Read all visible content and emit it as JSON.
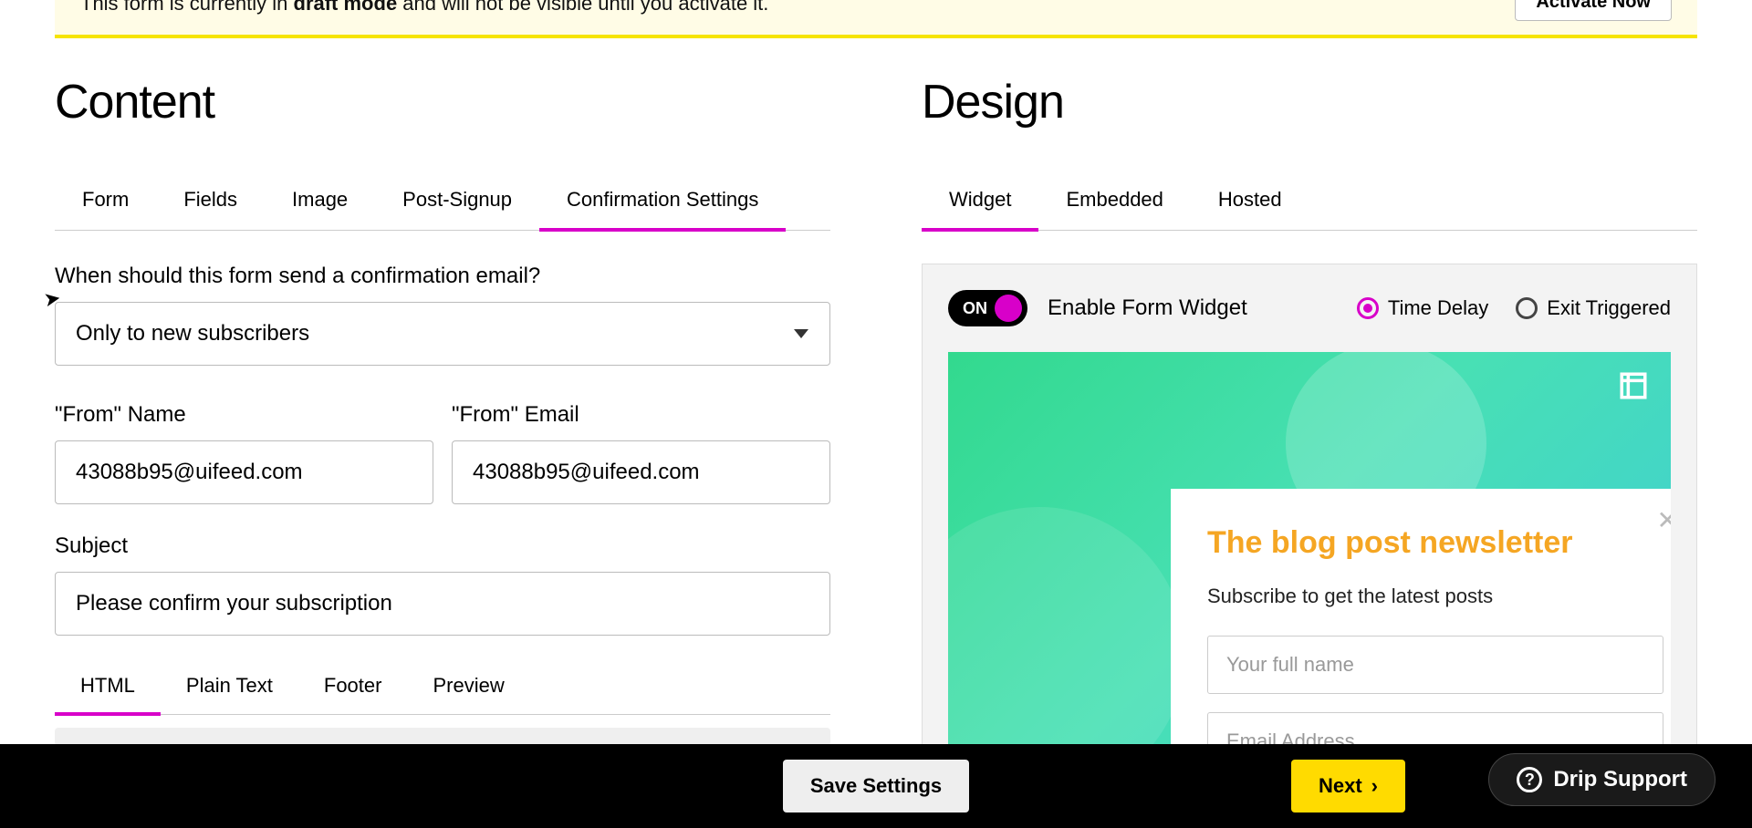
{
  "banner": {
    "prefix": "This form is currently in ",
    "bold": "draft mode",
    "suffix": " and will not be visible until you activate it.",
    "button": "Activate Now"
  },
  "content": {
    "title": "Content",
    "tabs": [
      "Form",
      "Fields",
      "Image",
      "Post-Signup",
      "Confirmation Settings"
    ],
    "active_tab": 4,
    "confirmation_label": "When should this form send a confirmation email?",
    "confirmation_value": "Only to new subscribers",
    "from_name_label": "\"From\" Name",
    "from_name_value": "43088b95@uifeed.com",
    "from_email_label": "\"From\" Email",
    "from_email_value": "43088b95@uifeed.com",
    "subject_label": "Subject",
    "subject_value": "Please confirm your subscription",
    "editor_tabs": [
      "HTML",
      "Plain Text",
      "Footer",
      "Preview"
    ],
    "editor_active": 0
  },
  "design": {
    "title": "Design",
    "tabs": [
      "Widget",
      "Embedded",
      "Hosted"
    ],
    "active_tab": 0,
    "toggle_label": "ON",
    "enable_label": "Enable Form Widget",
    "radio_time": "Time Delay",
    "radio_exit": "Exit Triggered",
    "popup": {
      "title": "The blog post newsletter",
      "subtitle": "Subscribe to get the latest posts",
      "name_placeholder": "Your full name",
      "email_placeholder": "Email Address"
    }
  },
  "footer": {
    "save": "Save Settings",
    "next": "Next",
    "support": "Drip Support"
  }
}
